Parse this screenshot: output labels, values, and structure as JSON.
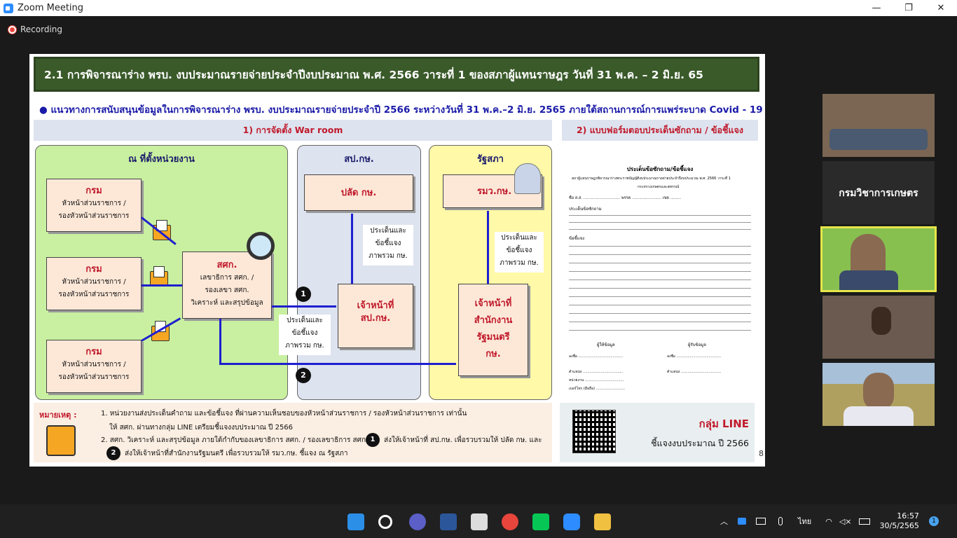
{
  "window": {
    "title": "Zoom Meeting",
    "minimize": "—",
    "maximize": "❐",
    "close": "✕"
  },
  "recording": {
    "label": "Recording"
  },
  "slide": {
    "title": "2.1 การพิจารณาร่าง พรบ. งบประมาณรายจ่ายประจำปีงบประมาณ พ.ศ. 2566 วาระที่ 1 ของสภาผู้แทนราษฎร วันที่ 31 พ.ค. – 2 มิ.ย. 65",
    "subtitle": "● แนวทางการสนับสนุนข้อมูลในการพิจารณาร่าง พรบ. งบประมาณรายจ่ายประจำปี 2566 ระหว่างวันที่ 31 พ.ค.–2 มิ.ย. 2565 ภายใต้สถานการณ์การแพร่ระบาด Covid - 19",
    "section1": "1) การจัดตั้ง War room",
    "section2": "2) แบบฟอร์มตอบประเด็นซักถาม / ข้อชี้แจง",
    "panel_unit": "ณ ที่ตั้งหน่วยงาน",
    "panel_opk": "สป.กษ.",
    "panel_parliament": "รัฐสภา",
    "dept_title": "กรม",
    "dept_line1": "หัวหน้าส่วนราชการ /",
    "dept_line2": "รองหัวหน้าส่วนราชการ",
    "sok_title": "สศก.",
    "sok_line1": "เลขาธิการ สศก. /",
    "sok_line2": "รองเลขา สศก.",
    "sok_line3": "วิเคราะห์ และสรุปข้อมูล",
    "palad": "ปลัด กษ.",
    "opk_staff": "เจ้าหน้าที่",
    "opk_staff2": "สป.กษ.",
    "minister": "รมว.กษ.",
    "pm_staff1": "เจ้าหน้าที่",
    "pm_staff2": "สำนักงาน",
    "pm_staff3": "รัฐมนตรี",
    "pm_staff4": "กษ.",
    "issue1": "ประเด็นและ",
    "issue2": "ข้อชี้แจง",
    "issue3": "ภาพรวม กษ.",
    "step1": "1",
    "step2": "2",
    "form": {
      "title": "ประเด็นข้อซักถาม/ข้อชี้แจง",
      "sub": "สภาผู้แทนราษฎรพิจารณาร่างพระราชบัญญัติงบประมาณรายจ่ายประจำปีงบประมาณ พ.ศ. 2566 วาระที่ 1",
      "ministry": "กระทรวงเกษตรและสหกรณ์",
      "name": "ชื่อ ส.ส. .............................. พรรค ........................ เขต .........",
      "q": "ประเด็นข้อซักถาม",
      "a": "ข้อชี้แจง",
      "sig1": "ผู้ให้ข้อมูล",
      "sig2": "ผู้รับข้อมูล",
      "s_sign": "ลงชื่อ ........................................",
      "s_pos": "ตำแหน่ง ....................................",
      "s_unit": "หน่วยงาน ...................................",
      "s_tel": "เบอร์โทร (มือถือ) .........................."
    },
    "remarks": {
      "label": "หมายเหตุ :",
      "l1": "1. หน่วยงานส่งประเด็นคำถาม และข้อชี้แจง ที่ผ่านความเห็นชอบของหัวหน้าส่วนราชการ / รองหัวหน้าส่วนราชการ เท่านั้น",
      "l2": "ให้ สศก. ผ่านทางกลุ่ม LINE เตรียมชี้แจงงบประมาณ ปี 2566",
      "l3a": "2. สศก. วิเคราะห์ และสรุปข้อมูล ภายใต้กำกับของเลขาธิการ สศก. / รองเลขาธิการ สศก.",
      "l3b": "ส่งให้เจ้าหน้าที่ สป.กษ. เพื่อรวบรวมให้ ปลัด กษ. และ",
      "l4": "ส่งให้เจ้าหน้าที่สำนักงานรัฐมนตรี เพื่อรวบรวมให้ รมว.กษ. ชี้แจง ณ รัฐสภา"
    },
    "line_group": {
      "title": "กลุ่ม LINE",
      "subtitle": "ชี้แจงงบประมาณ ปี 2566"
    },
    "page_number": "8"
  },
  "participants": {
    "name_tile": "กรมวิชาการเกษตร"
  },
  "taskbar": {
    "lang": "ไทย",
    "time": "16:57",
    "date": "30/5/2565",
    "badge": "1"
  }
}
